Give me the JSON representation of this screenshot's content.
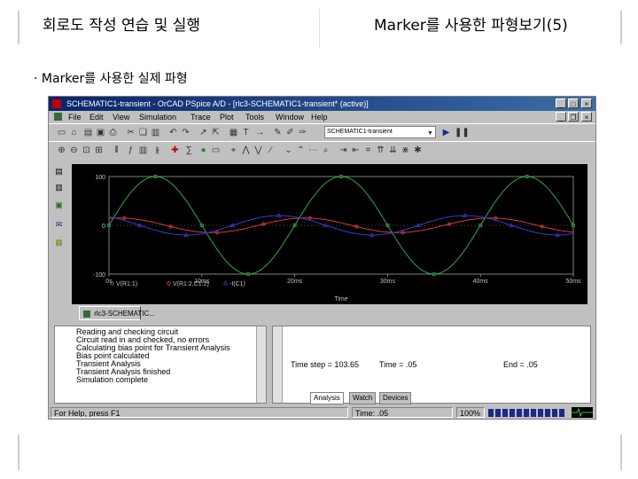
{
  "slide": {
    "title_left": "회로도 작성 연습 및 실행",
    "title_right": "Marker를 사용한 파형보기(5)",
    "bullet_mark": "·",
    "bullet_text": "Marker를 사용한 실제 파형"
  },
  "window": {
    "title": "SCHEMATIC1-transient - OrCAD PSpice A/D - [rlc3-SCHEMATIC1-transient* (active)]",
    "menu": [
      "File",
      "Edit",
      "View",
      "Simulation",
      "Trace",
      "Plot",
      "Tools",
      "Window",
      "Help"
    ],
    "sim_profile": "SCHEMATIC1-transient",
    "doc_tab": "rlc3-SCHEMATIC...",
    "output_lines": [
      "Reading and checking circuit",
      "Circuit read in and checked, no errors",
      "Calculating bias point for Transient Analysis",
      "Bias point calculated",
      "Transient Analysis",
      "Transient Analysis finished",
      "Simulation complete"
    ],
    "sim_status": {
      "time_step": "Time step = 103.65",
      "time": "Time = .05",
      "end": "End = .05"
    },
    "bottom_tabs": [
      "Analysis",
      "Watch",
      "Devices"
    ],
    "status": {
      "help": "For Help, press F1",
      "time": "Time: .05",
      "percent": "100%"
    }
  },
  "chart_data": {
    "type": "line",
    "xlabel": "Time",
    "xlim": [
      0,
      50
    ],
    "ylim": [
      -100,
      100
    ],
    "x_ticks": [
      "0s",
      "10ms",
      "20ms",
      "30ms",
      "40ms",
      "50ms"
    ],
    "y_ticks": [
      "100",
      "0",
      "-100"
    ],
    "series": [
      {
        "name": "V(R1:1)",
        "color": "#2ea84a",
        "amplitude": 100,
        "period_ms": 20,
        "phase_deg": 0,
        "marker": "square"
      },
      {
        "name": "V(R1:2,C1:2)",
        "color": "#d63a3a",
        "amplitude": 15,
        "period_ms": 20,
        "phase_deg": 70,
        "marker": "diamond"
      },
      {
        "name": "-I(C1)",
        "color": "#3a3ad6",
        "amplitude": 20,
        "period_ms": 20,
        "phase_deg": 120,
        "marker": "triangle"
      }
    ]
  },
  "icons": {
    "toolbar1_left": [
      "new",
      "open",
      "save",
      "print",
      "cut",
      "copy",
      "paste",
      "undo",
      "redo",
      "zoom",
      "marker",
      "run",
      "pause"
    ]
  }
}
